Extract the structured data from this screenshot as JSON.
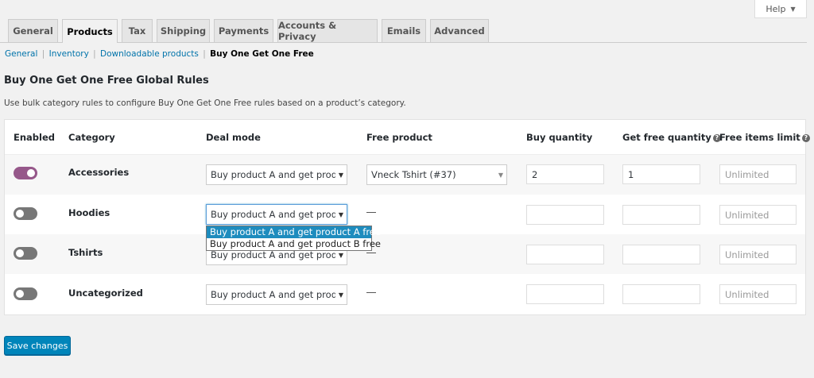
{
  "help": {
    "label": "Help"
  },
  "tabs": [
    {
      "label": "General"
    },
    {
      "label": "Products"
    },
    {
      "label": "Tax"
    },
    {
      "label": "Shipping"
    },
    {
      "label": "Payments"
    },
    {
      "label": "Accounts & Privacy"
    },
    {
      "label": "Emails"
    },
    {
      "label": "Advanced"
    }
  ],
  "active_tab": "Products",
  "subnav": {
    "general": "General",
    "inventory": "Inventory",
    "downloadable": "Downloadable products",
    "current": "Buy One Get One Free",
    "separator": "|"
  },
  "page": {
    "heading": "Buy One Get One Free Global Rules",
    "description": "Use bulk category rules to configure Buy One Get One Free rules based on a product’s category."
  },
  "table": {
    "headers": {
      "enabled": "Enabled",
      "category": "Category",
      "deal_mode": "Deal mode",
      "free_product": "Free product",
      "buy_qty": "Buy quantity",
      "get_free_qty": "Get free quantity",
      "limit": "Free items limit"
    },
    "rows": [
      {
        "enabled": true,
        "category": "Accessories",
        "deal_mode": "Buy product A and get product A free",
        "free_product": "Vneck Tshirt (#37)",
        "buy_qty": "2",
        "get_free_qty": "1",
        "limit_placeholder": "Unlimited"
      },
      {
        "enabled": false,
        "category": "Hoodies",
        "deal_mode": "Buy product A and get product A free",
        "free_product": "",
        "buy_qty": "",
        "get_free_qty": "",
        "limit_placeholder": "Unlimited"
      },
      {
        "enabled": false,
        "category": "Tshirts",
        "deal_mode": "Buy product A and get product A free",
        "free_product": "",
        "buy_qty": "",
        "get_free_qty": "",
        "limit_placeholder": "Unlimited"
      },
      {
        "enabled": false,
        "category": "Uncategorized",
        "deal_mode": "Buy product A and get product A free",
        "free_product": "",
        "buy_qty": "",
        "get_free_qty": "",
        "limit_placeholder": "Unlimited"
      }
    ]
  },
  "dropdown_options": [
    "Buy product A and get product A free",
    "Buy product A and get product B free"
  ],
  "save": {
    "label": "Save changes"
  },
  "icons": {
    "help_tip": "help-circle-icon",
    "caret": "caret-down-icon",
    "dash": "em-dash"
  },
  "colors": {
    "accent": "#96588a",
    "primary_button": "#0085ba",
    "link": "#0073aa",
    "highlight": "#1e8cbe"
  }
}
